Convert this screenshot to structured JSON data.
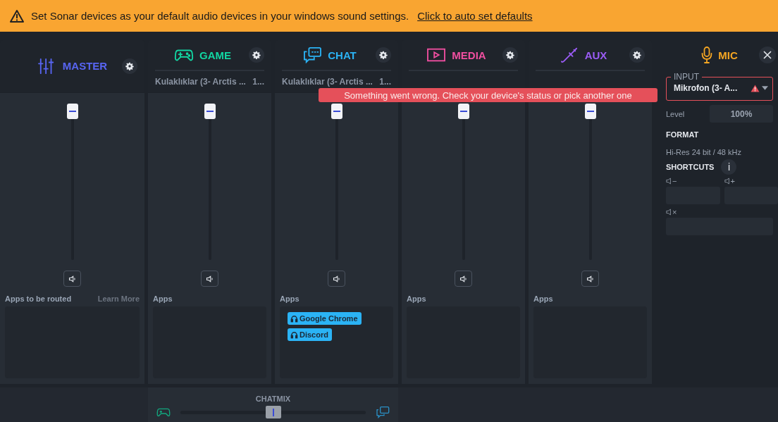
{
  "banner": {
    "message": "Set Sonar devices as your default audio devices in your windows sound settings.",
    "link": "Click to auto set defaults"
  },
  "channels": [
    {
      "kind": "master",
      "name": "MASTER",
      "color": "#5865f2",
      "level": 1,
      "apps_label": "Apps to be routed",
      "learn_more": "Learn More"
    },
    {
      "kind": "game",
      "name": "GAME",
      "color": "#12d6a2",
      "device": "Kulaklıklar (3- Arctis ...",
      "device_level": "1...",
      "level": 1,
      "apps_label": "Apps"
    },
    {
      "kind": "chat",
      "name": "CHAT",
      "color": "#2bb3f5",
      "device": "Kulaklıklar (3- Arctis ...",
      "device_level": "1...",
      "level": 1,
      "apps_label": "Apps",
      "apps": [
        "Google Chrome",
        "Discord"
      ]
    },
    {
      "kind": "media",
      "name": "MEDIA",
      "color": "#f04fa0",
      "level": 1,
      "apps_label": "Apps"
    },
    {
      "kind": "aux",
      "name": "AUX",
      "color": "#9b5cf6",
      "level": 1,
      "apps_label": "Apps"
    }
  ],
  "chatmix": {
    "label": "CHATMIX",
    "level": 0.5
  },
  "tooltip": "Something went wrong. Check your device's status or pick another one",
  "mic": {
    "name": "MIC",
    "input_legend": "INPUT",
    "input_value": "Mikrofon (3- A...",
    "error": true,
    "level_label": "Level",
    "level_value": "100%",
    "format_heading": "FORMAT",
    "format_value": "Hi-Res 24 bit / 48 kHz",
    "shortcuts_heading": "SHORTCUTS",
    "info": "i",
    "shortcuts": [
      {
        "symbol": "−"
      },
      {
        "symbol": "+"
      },
      {
        "symbol": "×"
      }
    ]
  }
}
